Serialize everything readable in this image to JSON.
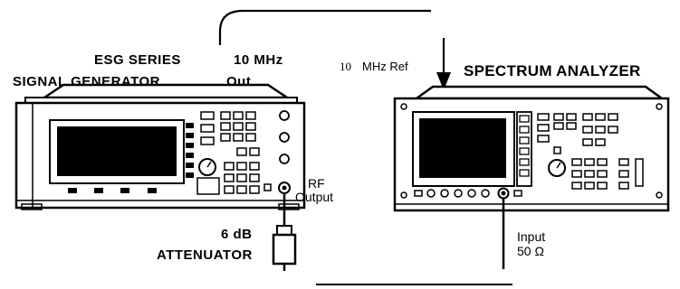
{
  "signal_generator": {
    "label_line1": "ESG SERIES",
    "label_line2": "SIGNAL GENERATOR",
    "out_freq": "10 MHz",
    "out_word": "Out",
    "rf_label_line1": "RF",
    "rf_label_line2": "Output"
  },
  "spectrum_analyzer": {
    "title": "SPECTRUM ANALYZER",
    "ref_in_num": "10",
    "ref_in_label": "MHz Ref",
    "input_label_line1": "Input",
    "input_label_line2": "50 Ω"
  },
  "attenuator": {
    "value": "6 dB",
    "name": "ATTENUATOR"
  }
}
